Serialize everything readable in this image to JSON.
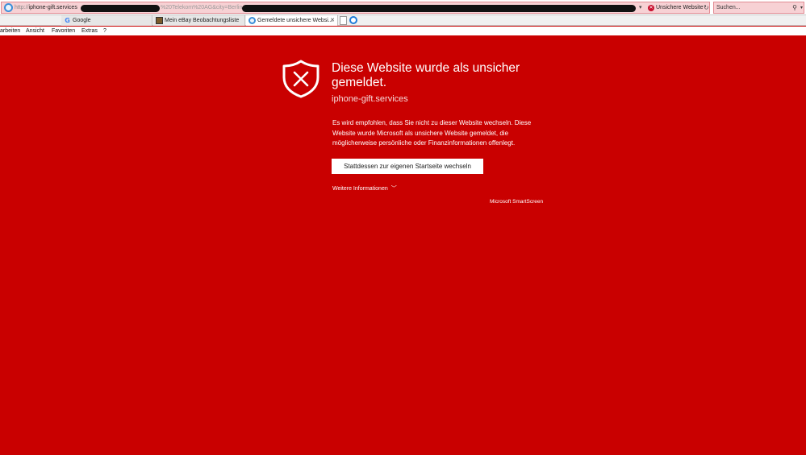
{
  "address_bar": {
    "url_prefix": "http://",
    "url_domain": "iphone-gift.services",
    "url_tail": "%20Telekom%20AG&city=Berlin",
    "security_status": "Unsichere Website"
  },
  "search": {
    "placeholder": "Suchen..."
  },
  "tabs": [
    {
      "label": "Google",
      "icon": "google-icon"
    },
    {
      "label": "Mein eBay Beobachtungsliste",
      "icon": "ebay-icon"
    },
    {
      "label": "Gemeldete unsichere Websi...",
      "icon": "ie-icon",
      "active": true
    }
  ],
  "menu": {
    "items": [
      "arbeiten",
      "Ansicht",
      "Favoriten",
      "Extras",
      "?"
    ]
  },
  "warning": {
    "title": "Diese Website wurde als unsicher gemeldet.",
    "domain": "iphone-gift.services",
    "description": "Es wird empfohlen, dass Sie nicht zu dieser Website wechseln. Diese Website wurde Microsoft als unsichere Website gemeldet, die möglicherweise persönliche oder Finanzinformationen offenlegt.",
    "home_button": "Stattdessen zur eigenen Startseite wechseln",
    "more_info": "Weitere Informationen",
    "brand": "Microsoft SmartScreen"
  },
  "colors": {
    "page_background": "#c90000",
    "address_bar_background": "#f7d1d4"
  }
}
